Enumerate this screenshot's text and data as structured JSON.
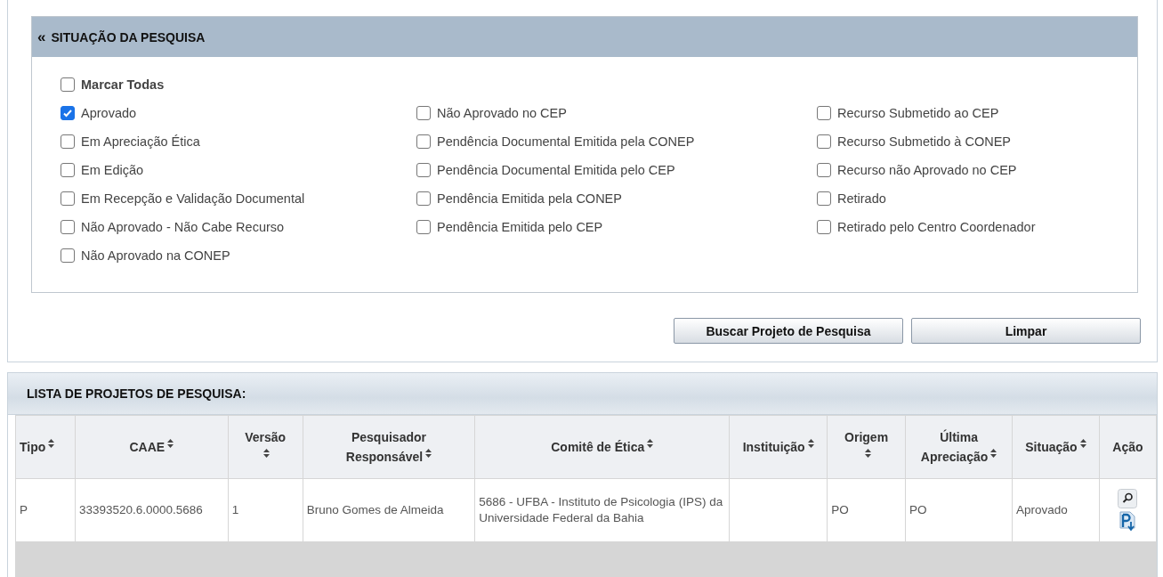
{
  "filter_panel": {
    "toggle": "«",
    "title": "SITUAÇÃO DA PESQUISA",
    "select_all": {
      "label": "Marcar Todas",
      "checked": false
    },
    "columns": [
      [
        {
          "label": "Aprovado",
          "checked": true
        },
        {
          "label": "Em Apreciação Ética",
          "checked": false
        },
        {
          "label": "Em Edição",
          "checked": false
        },
        {
          "label": "Em Recepção e Validação Documental",
          "checked": false
        },
        {
          "label": "Não Aprovado - Não Cabe Recurso",
          "checked": false
        },
        {
          "label": "Não Aprovado na CONEP",
          "checked": false
        }
      ],
      [
        {
          "label": "Não Aprovado no CEP",
          "checked": false
        },
        {
          "label": "Pendência Documental Emitida pela CONEP",
          "checked": false
        },
        {
          "label": "Pendência Documental Emitida pelo CEP",
          "checked": false
        },
        {
          "label": "Pendência Emitida pela CONEP",
          "checked": false
        },
        {
          "label": "Pendência Emitida pelo CEP",
          "checked": false
        }
      ],
      [
        {
          "label": "Recurso Submetido ao CEP",
          "checked": false
        },
        {
          "label": "Recurso Submetido à CONEP",
          "checked": false
        },
        {
          "label": "Recurso não Aprovado no CEP",
          "checked": false
        },
        {
          "label": "Retirado",
          "checked": false
        },
        {
          "label": "Retirado pelo Centro Coordenador",
          "checked": false
        }
      ]
    ]
  },
  "buttons": [
    "Buscar Projeto de Pesquisa",
    "Limpar"
  ],
  "results": {
    "title": "LISTA DE PROJETOS DE PESQUISA:",
    "columns": [
      {
        "label": "Tipo",
        "sortable": true
      },
      {
        "label": "CAAE",
        "sortable": true
      },
      {
        "label": "Versão",
        "sortable": true
      },
      {
        "label": "Pesquisador Responsável",
        "sortable": true
      },
      {
        "label": "Comitê de Ética",
        "sortable": true
      },
      {
        "label": "Instituição",
        "sortable": true
      },
      {
        "label": "Origem",
        "sortable": true
      },
      {
        "label": "Última Apreciação",
        "sortable": true
      },
      {
        "label": "Situação",
        "sortable": true
      },
      {
        "label": "Ação",
        "sortable": false
      }
    ],
    "rows": [
      {
        "cells": [
          "P",
          "33393520.6.0000.5686",
          "1",
          "Bruno Gomes de Almeida",
          "5686 - UFBA - Instituto de Psicologia (IPS) da Universidade Federal da Bahia",
          "",
          "PO",
          "PO",
          "Aprovado"
        ]
      }
    ]
  }
}
